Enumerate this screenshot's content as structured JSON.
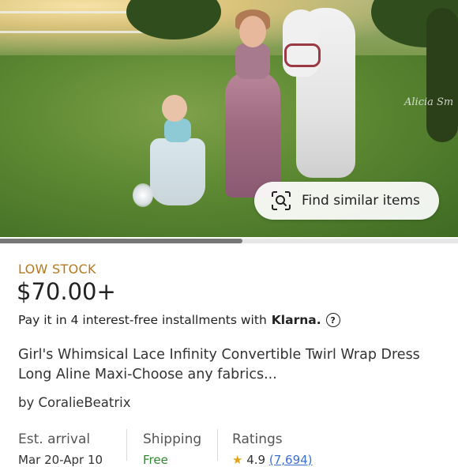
{
  "image": {
    "find_similar_label": "Find similar items",
    "watermark": "Alicia Sm",
    "gallery_progress": 0.53
  },
  "product": {
    "stock_label": "LOW STOCK",
    "price": "$70.00+",
    "installments_text": "Pay it in 4 interest-free installments with",
    "installments_brand": "Klarna.",
    "title": "Girl's Whimsical Lace Infinity Convertible Twirl Wrap Dress  Long Aline Maxi-Choose any fabrics...",
    "seller_prefix": "by",
    "seller_name": "CoralieBeatrix"
  },
  "meta": {
    "arrival_label": "Est. arrival",
    "arrival_value": "Mar 20-Apr 10",
    "shipping_label": "Shipping",
    "shipping_value": "Free",
    "ratings_label": "Ratings",
    "ratings_value": "4.9",
    "ratings_count": "(7,694)"
  },
  "colors": {
    "stock": "#b5791b",
    "free_shipping": "#2f8b2f",
    "rating_link": "#3b6fd4"
  }
}
